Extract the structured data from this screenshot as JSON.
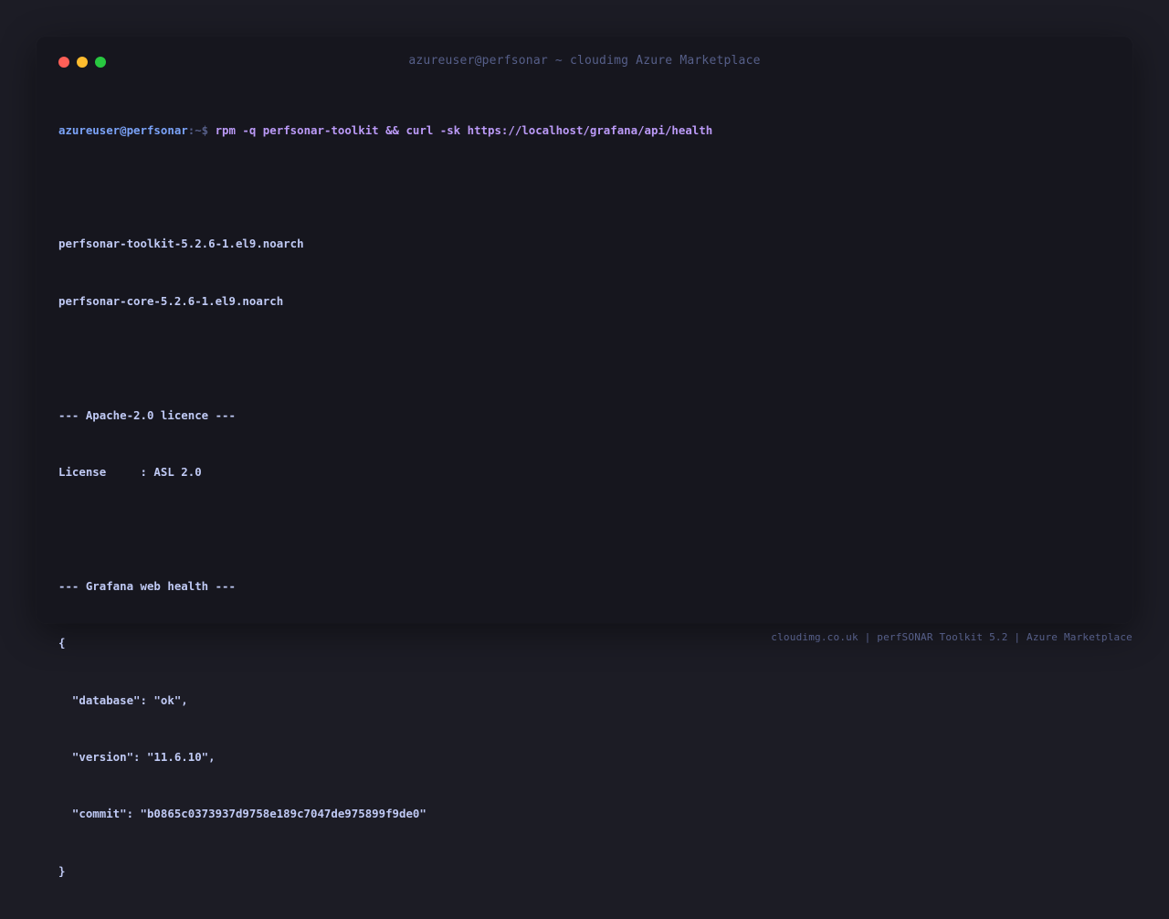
{
  "window": {
    "title": "azureuser@perfsonar ~ cloudimg Azure Marketplace"
  },
  "terminal": {
    "prompt_user": "azureuser@perfsonar",
    "prompt_path": ":~$ ",
    "command": "rpm -q perfsonar-toolkit && curl -sk https://localhost/grafana/api/health",
    "output": [
      "",
      "perfsonar-toolkit-5.2.6-1.el9.noarch",
      "perfsonar-core-5.2.6-1.el9.noarch",
      "",
      "--- Apache-2.0 licence ---",
      "License     : ASL 2.0",
      "",
      "--- Grafana web health ---",
      "{",
      "  \"database\": \"ok\",",
      "  \"version\": \"11.6.10\",",
      "  \"commit\": \"b0865c0373937d9758e189c7047de975899f9de0\"",
      "}"
    ]
  },
  "footer": {
    "text": "cloudimg.co.uk | perfSONAR Toolkit 5.2 | Azure Marketplace"
  },
  "colors": {
    "background": "#1c1c25",
    "window": "#16161e",
    "prompt_user": "#7aa2f7",
    "command": "#bb9af7",
    "output": "#c0caf5",
    "muted": "#565f89",
    "close": "#ff5f57",
    "minimize": "#febc2e",
    "maximize": "#28c840"
  },
  "icons": {
    "close": "close-dot-icon",
    "minimize": "minimize-dot-icon",
    "maximize": "maximize-dot-icon"
  }
}
